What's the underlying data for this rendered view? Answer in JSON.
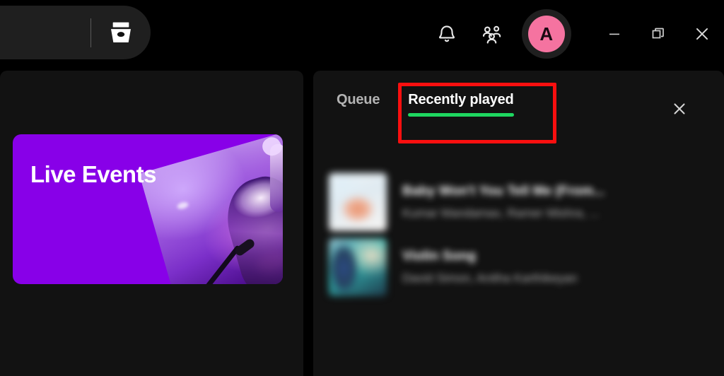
{
  "app": {
    "background": "#000000",
    "panel_background": "#121212",
    "accent_green": "#1ed760",
    "annotation_color": "#fa0f0f",
    "avatar_color": "#f573a0",
    "live_events_purple": "#8800e8"
  },
  "topbar": {
    "nav_pill": {
      "icon_name": "archive-box-icon"
    },
    "notifications_label": "Notifications",
    "friend_activity_label": "Friend Activity",
    "avatar_initial": "A",
    "window_controls": {
      "minimize_label": "Minimize",
      "restore_label": "Restore",
      "close_label": "Close"
    }
  },
  "left_panel": {
    "live_events_card": {
      "title": "Live Events"
    }
  },
  "right_panel": {
    "tabs": [
      {
        "label": "Queue",
        "active": false
      },
      {
        "label": "Recently played",
        "active": true
      }
    ],
    "close_label": "Close panel",
    "tracks": [
      {
        "title": "Baby Won't You Tell Me (From...",
        "artist": "Kumar Mandamax, Ramer Mishra, ..."
      },
      {
        "title": "Violin Song",
        "artist": "David Simon, Anitha Karthikeyan"
      }
    ]
  }
}
